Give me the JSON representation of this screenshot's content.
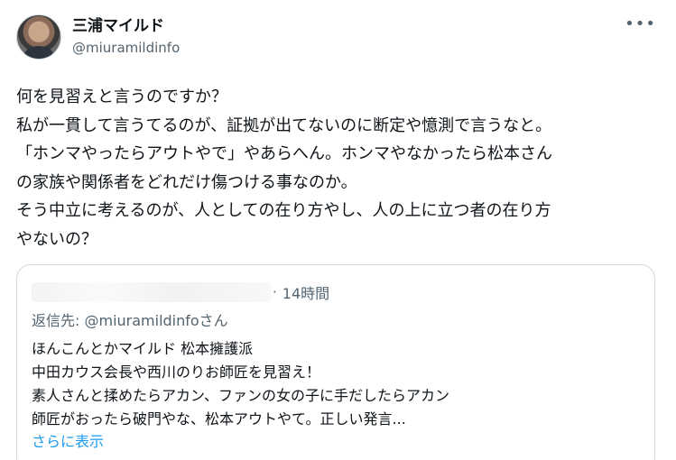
{
  "author": {
    "display_name": "三浦マイルド",
    "handle": "@miuramildinfo"
  },
  "menu_icon": "more-horizontal-icon",
  "tweet_text": "何を見習えと言うのですか？\n私が一貫して言うてるのが、証拠が出てないのに断定や憶測で言うなと。\n「ホンマやったらアウトやで」やあらへん。ホンマやなかったら松本さん\nの家族や関係者をどれだけ傷つける事なのか。\nそう中立に考えるのが、人としての在り方やし、人の上に立つ者の在り方\nやないの？",
  "quoted": {
    "separator": "·",
    "time": "14時間",
    "replying_to": "返信先: @miuramildinfoさん",
    "text": "ほんこんとかマイルド 松本擁護派\n中田カウス会長や西川のりお師匠を見習え！\n素人さんと揉めたらアカン、ファンの女の子に手だしたらアカン\n師匠がおったら破門やな、松本アウトやて。正しい発言...",
    "show_more": "さらに表示"
  }
}
